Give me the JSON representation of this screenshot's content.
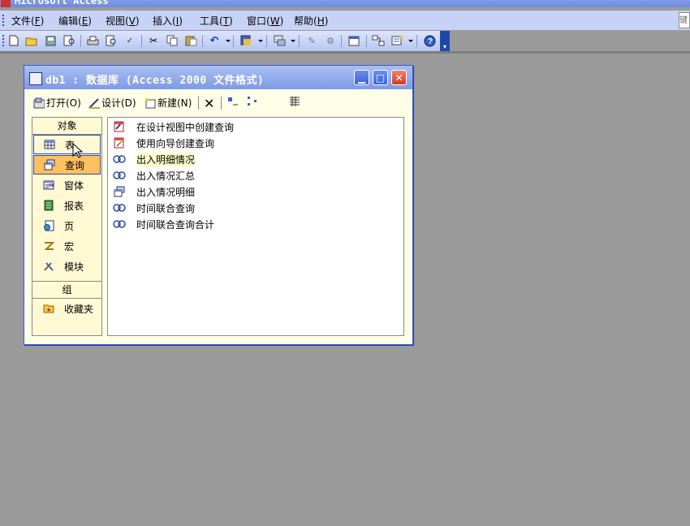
{
  "app": {
    "title": "Microsoft Access"
  },
  "menu": [
    {
      "label": "文件(",
      "acc": "F",
      "end": ")"
    },
    {
      "label": "编辑(",
      "acc": "E",
      "end": ")"
    },
    {
      "label": "视图(",
      "acc": "V",
      "end": ")"
    },
    {
      "label": "插入(",
      "acc": "I",
      "end": ")"
    },
    {
      "label": "工具(",
      "acc": "T",
      "end": ")"
    },
    {
      "label": "窗口(",
      "acc": "W",
      "end": ")"
    },
    {
      "label": "帮助(",
      "acc": "H",
      "end": ")"
    }
  ],
  "right_box_text": "键",
  "db_window": {
    "title": "db1 : 数据库 (Access 2000 文件格式)",
    "toolbar": {
      "open": "打开(O)",
      "design": "设计(D)",
      "new": "新建(N)"
    },
    "objects_header": "对象",
    "objects": [
      "表",
      "查询",
      "窗体",
      "报表",
      "页",
      "宏",
      "模块"
    ],
    "selected_object": "查询",
    "groups_header": "组",
    "groups": [
      "收藏夹"
    ],
    "items": [
      "在设计视图中创建查询",
      "使用向导创建查询",
      "出入明细情况",
      "出入情况汇总",
      "出入情况明细",
      "时间联合查询",
      "时间联合查询合计"
    ]
  },
  "colors": {
    "desktop": "#9a9a9a",
    "selection": "#ffc060",
    "accent": "#2d4eb0"
  }
}
